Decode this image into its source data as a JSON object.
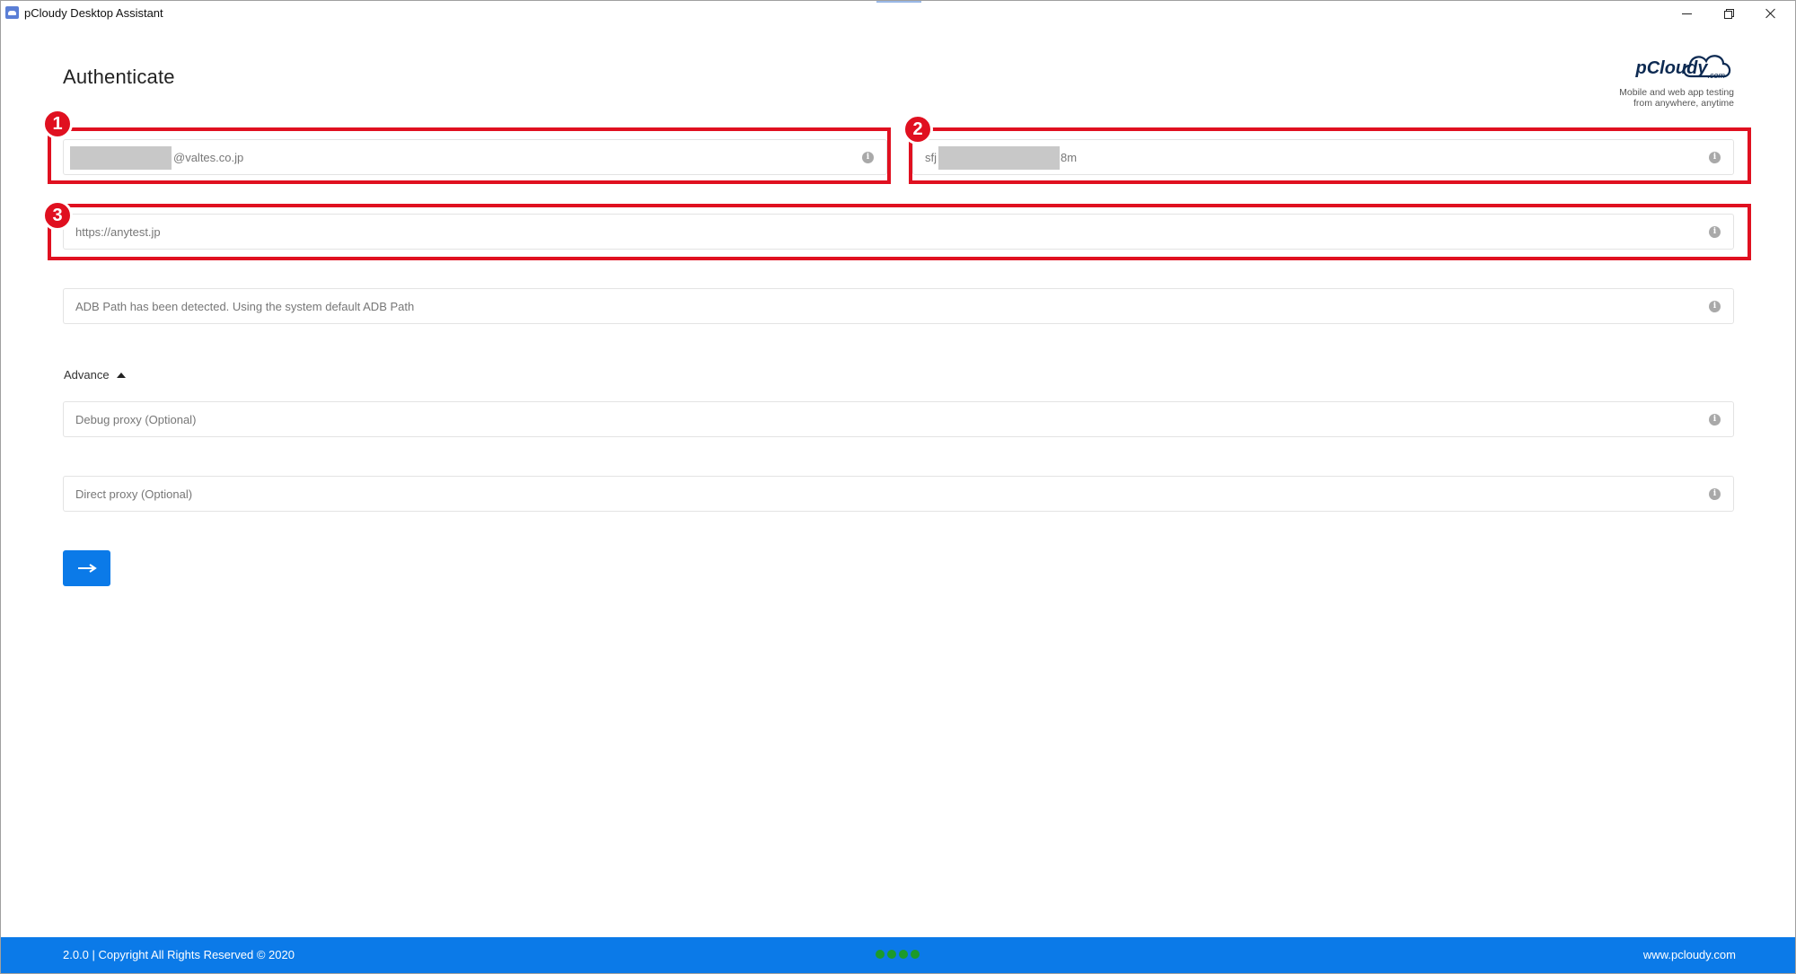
{
  "window": {
    "title": "pCloudy Desktop Assistant"
  },
  "page": {
    "title": "Authenticate"
  },
  "logo": {
    "word": "pCloudy",
    "suffix": ".com",
    "tagline_line1": "Mobile and web app testing",
    "tagline_line2": "from anywhere, anytime"
  },
  "form": {
    "email_value": "@valtes.co.jp",
    "apikey_prefix": "sfj",
    "apikey_suffix": "8m",
    "url_value": "https://anytest.jp",
    "adb_value": "ADB Path has been detected. Using the system default ADB Path",
    "advance_label": "Advance",
    "debug_proxy_placeholder": "Debug proxy (Optional)",
    "direct_proxy_placeholder": "Direct proxy (Optional)",
    "info_glyph": "i"
  },
  "annotations": {
    "badge1": "1",
    "badge2": "2",
    "badge3": "3"
  },
  "footer": {
    "copyright": "2.0.0 | Copyright All Rights Reserved © 2020",
    "website": "www.pcloudy.com"
  },
  "colors": {
    "accent": "#0b7ae8",
    "annotation": "#e01020",
    "status_dots": "#1c9a2a"
  }
}
